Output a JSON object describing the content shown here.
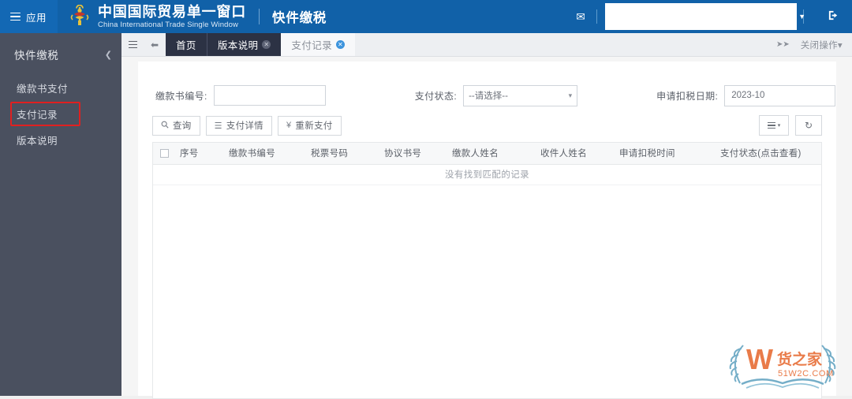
{
  "header": {
    "apps_button": "应用",
    "apps_icon": "hamburger-icon",
    "emblem_icon": "china-customs-emblem",
    "brand_cn": "中国国际贸易单一窗口",
    "brand_en": "China International Trade Single Window",
    "system_title": "快件缴税",
    "mail_icon": "envelope-icon",
    "user_value": "",
    "user_caret_icon": "chevron-down-icon",
    "logout_icon": "logout-icon"
  },
  "sidebar": {
    "title": "快件缴税",
    "collapse_icon": "chevron-left-icon",
    "items": [
      {
        "label": "缴款书支付",
        "highlighted": false
      },
      {
        "label": "支付记录",
        "highlighted": true
      },
      {
        "label": "版本说明",
        "highlighted": false
      }
    ],
    "highlight_color": "#e02020",
    "background_color": "#4a505f"
  },
  "tabbar": {
    "menu_icon": "hamburger-icon",
    "prev_icon": "double-chevron-left-icon",
    "tabs": [
      {
        "label": "首页",
        "closable": false,
        "state": "dark"
      },
      {
        "label": "版本说明",
        "closable": true,
        "state": "dark"
      },
      {
        "label": "支付记录",
        "closable": true,
        "state": "active"
      }
    ],
    "next_icon": "double-chevron-right-icon",
    "close_ops_label": "关闭操作",
    "close_ops_caret": "caret-down-icon"
  },
  "search_form": {
    "doc_no": {
      "label": "缴款书编号:",
      "value": "",
      "placeholder": ""
    },
    "pay_status": {
      "label": "支付状态:",
      "value": "--请选择--"
    },
    "deduct_date": {
      "label": "申请扣税日期:",
      "value": "2023-10"
    }
  },
  "toolbar": {
    "buttons": [
      {
        "label": "查询",
        "icon": "search-icon",
        "glyph": "Q"
      },
      {
        "label": "支付详情",
        "icon": "list-icon",
        "glyph": "☰"
      },
      {
        "label": "重新支付",
        "icon": "yen-icon",
        "glyph": "¥"
      }
    ],
    "columns_button": {
      "icon": "columns-list-icon",
      "caret": "caret-down-icon"
    },
    "refresh_button": {
      "icon": "refresh-icon",
      "glyph": "↻"
    }
  },
  "table": {
    "select_all_icon": "checkbox-icon",
    "columns": [
      "序号",
      "缴款书编号",
      "税票号码",
      "协议书号",
      "缴款人姓名",
      "收件人姓名",
      "申请扣税时间",
      "支付状态(点击查看)"
    ],
    "rows": [],
    "empty_message": "没有找到匹配的记录"
  },
  "watermark": {
    "letter": "W",
    "name": "货之家",
    "domain": "51W2C.COM",
    "letter_color": "#e8703a",
    "wreath_color": "#6aa8c4"
  }
}
